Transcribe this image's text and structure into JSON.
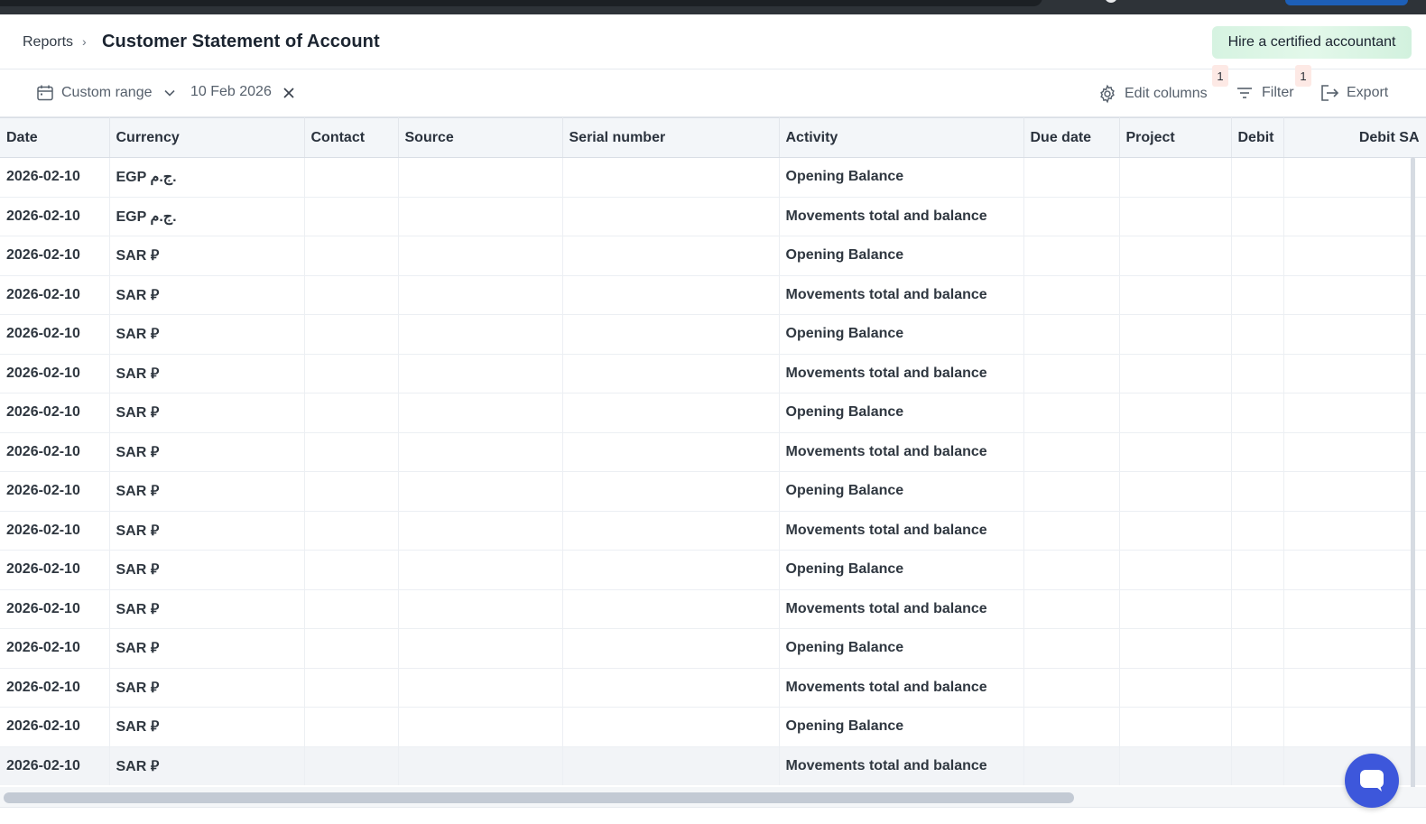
{
  "breadcrumb": {
    "parent": "Reports",
    "separator": "›",
    "title": "Customer Statement of Account"
  },
  "header": {
    "hire_button": "Hire a certified accountant"
  },
  "toolbar": {
    "range_label": "Custom range",
    "date_value": "10 Feb 2026",
    "edit_columns": "Edit columns",
    "filter": "Filter",
    "export": "Export",
    "edit_columns_badge": "1",
    "filter_badge": "1"
  },
  "table": {
    "columns": [
      "Date",
      "Currency",
      "Contact",
      "Source",
      "Serial number",
      "Activity",
      "Due date",
      "Project",
      "Debit",
      "Debit SA"
    ],
    "rows": [
      {
        "date": "2026-02-10",
        "currency": "EGP ج.م.",
        "activity": "Opening Balance"
      },
      {
        "date": "2026-02-10",
        "currency": "EGP ج.م.",
        "activity": "Movements total and balance"
      },
      {
        "date": "2026-02-10",
        "currency": "SAR ⃁",
        "activity": "Opening Balance"
      },
      {
        "date": "2026-02-10",
        "currency": "SAR ⃁",
        "activity": "Movements total and balance"
      },
      {
        "date": "2026-02-10",
        "currency": "SAR ⃁",
        "activity": "Opening Balance"
      },
      {
        "date": "2026-02-10",
        "currency": "SAR ⃁",
        "activity": "Movements total and balance"
      },
      {
        "date": "2026-02-10",
        "currency": "SAR ⃁",
        "activity": "Opening Balance"
      },
      {
        "date": "2026-02-10",
        "currency": "SAR ⃁",
        "activity": "Movements total and balance"
      },
      {
        "date": "2026-02-10",
        "currency": "SAR ⃁",
        "activity": "Opening Balance"
      },
      {
        "date": "2026-02-10",
        "currency": "SAR ⃁",
        "activity": "Movements total and balance"
      },
      {
        "date": "2026-02-10",
        "currency": "SAR ⃁",
        "activity": "Opening Balance"
      },
      {
        "date": "2026-02-10",
        "currency": "SAR ⃁",
        "activity": "Movements total and balance"
      },
      {
        "date": "2026-02-10",
        "currency": "SAR ⃁",
        "activity": "Opening Balance"
      },
      {
        "date": "2026-02-10",
        "currency": "SAR ⃁",
        "activity": "Movements total and balance"
      },
      {
        "date": "2026-02-10",
        "currency": "SAR ⃁",
        "activity": "Opening Balance"
      },
      {
        "date": "2026-02-10",
        "currency": "SAR ⃁",
        "activity": "Movements total and balance"
      }
    ],
    "highlighted_row": 15
  },
  "icons": {
    "calendar": "calendar-icon",
    "chevron": "chevron-down-icon",
    "clear": "close-icon",
    "gear": "gear-icon",
    "filter": "filter-icon",
    "export": "export-icon",
    "chat": "chat-icon"
  },
  "colors": {
    "hire_bg": "#d6f3e1",
    "header_bg": "#f3f6f9",
    "badge_bg": "#fde9e5",
    "chat_bg": "#3d57db"
  }
}
